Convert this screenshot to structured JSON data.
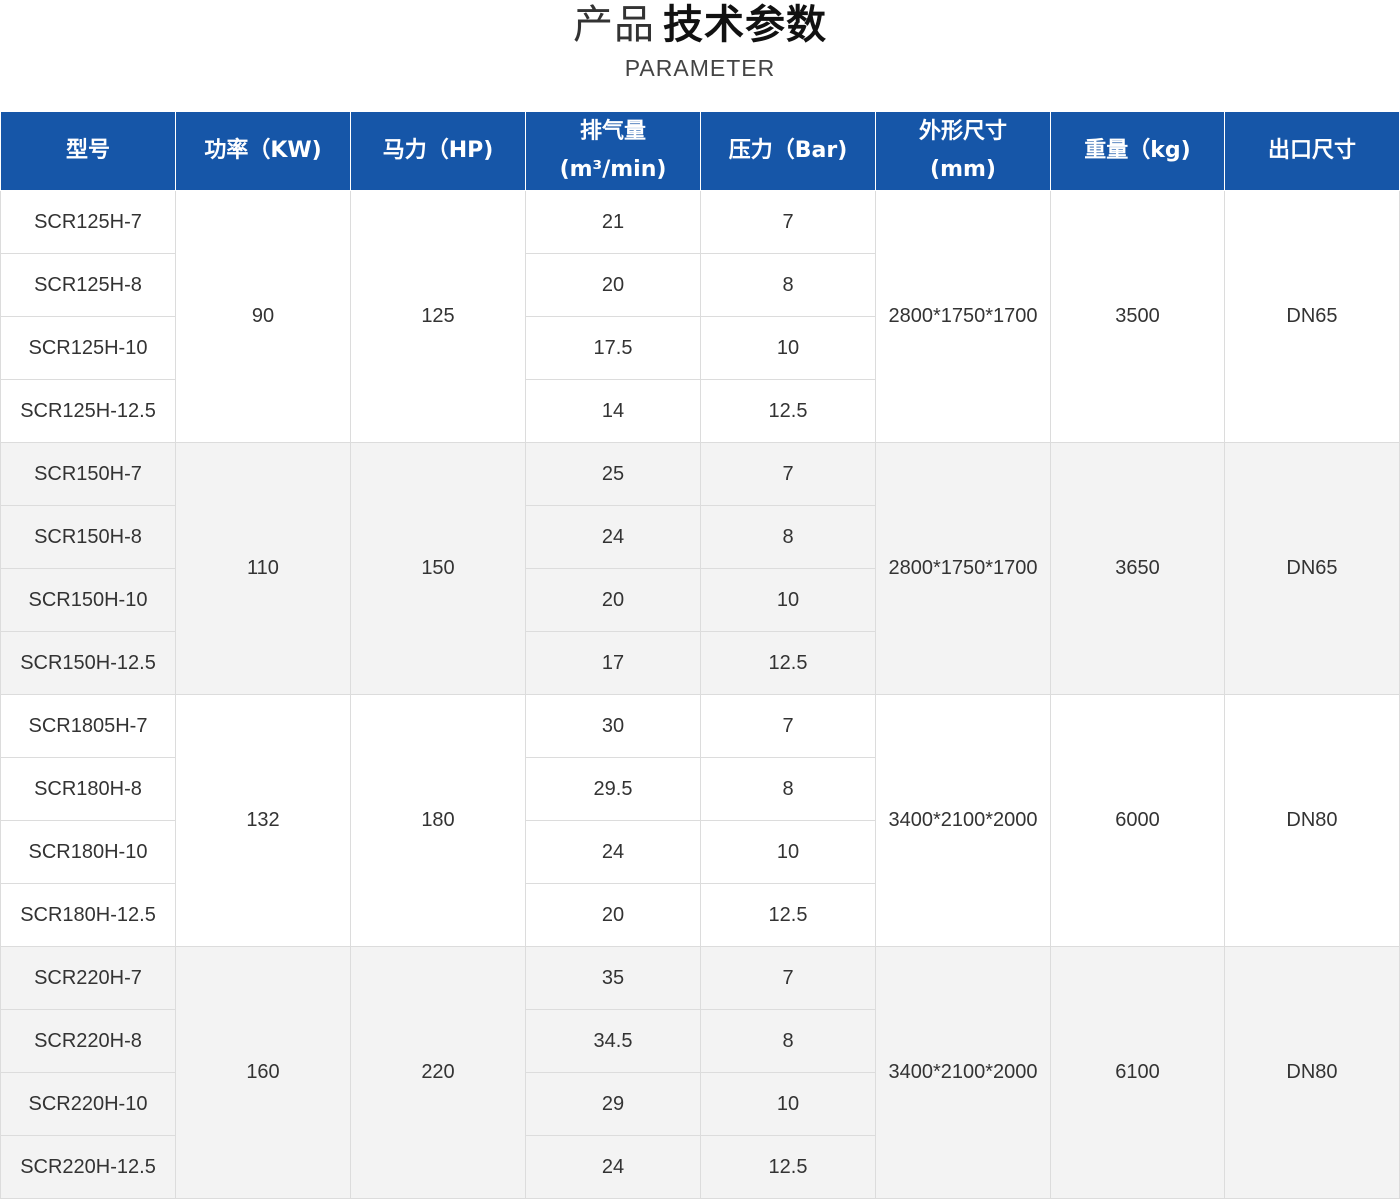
{
  "title": {
    "light": "产品",
    "bold": "技术参数",
    "sub": "PARAMETER"
  },
  "headers": {
    "model": "型号",
    "power": "功率（KW)",
    "hp": "马力（HP)",
    "air_line1": "排气量",
    "air_line2": "(m³/min)",
    "pressure": "压力（Bar)",
    "dims_line1": "外形尺寸",
    "dims_line2": "(mm)",
    "weight": "重量（kg)",
    "outlet": "出口尺寸"
  },
  "groups": [
    {
      "power": "90",
      "hp": "125",
      "dims": "2800*1750*1700",
      "weight": "3500",
      "outlet": "DN65",
      "rows": [
        {
          "model": "SCR125H-7",
          "air": "21",
          "pressure": "7"
        },
        {
          "model": "SCR125H-8",
          "air": "20",
          "pressure": "8"
        },
        {
          "model": "SCR125H-10",
          "air": "17.5",
          "pressure": "10"
        },
        {
          "model": "SCR125H-12.5",
          "air": "14",
          "pressure": "12.5"
        }
      ]
    },
    {
      "power": "110",
      "hp": "150",
      "dims": "2800*1750*1700",
      "weight": "3650",
      "outlet": "DN65",
      "rows": [
        {
          "model": "SCR150H-7",
          "air": "25",
          "pressure": "7"
        },
        {
          "model": "SCR150H-8",
          "air": "24",
          "pressure": "8"
        },
        {
          "model": "SCR150H-10",
          "air": "20",
          "pressure": "10"
        },
        {
          "model": "SCR150H-12.5",
          "air": "17",
          "pressure": "12.5"
        }
      ]
    },
    {
      "power": "132",
      "hp": "180",
      "dims": "3400*2100*2000",
      "weight": "6000",
      "outlet": "DN80",
      "rows": [
        {
          "model": "SCR1805H-7",
          "air": "30",
          "pressure": "7"
        },
        {
          "model": "SCR180H-8",
          "air": "29.5",
          "pressure": "8"
        },
        {
          "model": "SCR180H-10",
          "air": "24",
          "pressure": "10"
        },
        {
          "model": "SCR180H-12.5",
          "air": "20",
          "pressure": "12.5"
        }
      ]
    },
    {
      "power": "160",
      "hp": "220",
      "dims": "3400*2100*2000",
      "weight": "6100",
      "outlet": "DN80",
      "rows": [
        {
          "model": "SCR220H-7",
          "air": "35",
          "pressure": "7"
        },
        {
          "model": "SCR220H-8",
          "air": "34.5",
          "pressure": "8"
        },
        {
          "model": "SCR220H-10",
          "air": "29",
          "pressure": "10"
        },
        {
          "model": "SCR220H-12.5",
          "air": "24",
          "pressure": "12.5"
        }
      ]
    }
  ],
  "colors": {
    "header_bg": "#1656a8",
    "row_alt_bg": "#f3f3f3",
    "border": "#dcdcdc"
  }
}
